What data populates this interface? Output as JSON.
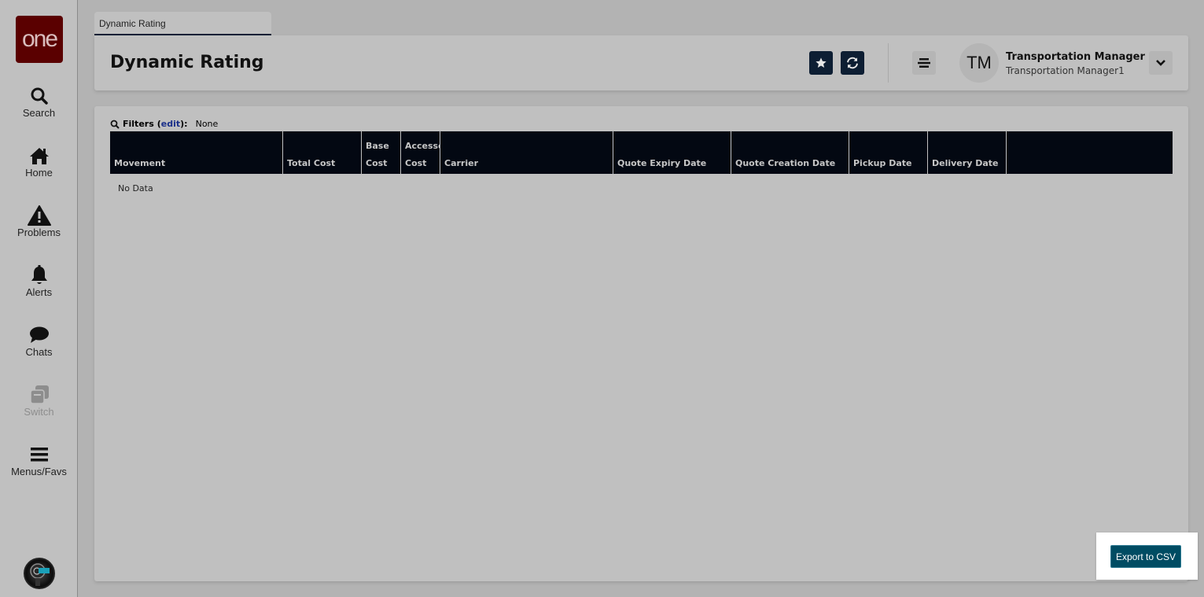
{
  "sidebar": {
    "logo_text": "one",
    "items": [
      {
        "label": "Search",
        "icon": "search-icon",
        "enabled": true
      },
      {
        "label": "Home",
        "icon": "home-icon",
        "enabled": true
      },
      {
        "label": "Problems",
        "icon": "warning-icon",
        "enabled": true
      },
      {
        "label": "Alerts",
        "icon": "bell-icon",
        "enabled": true
      },
      {
        "label": "Chats",
        "icon": "chat-bubble-icon",
        "enabled": true
      },
      {
        "label": "Switch",
        "icon": "switch-windows-icon",
        "enabled": false
      },
      {
        "label": "Menus/Favs",
        "icon": "hamburger-menu-icon",
        "enabled": true
      }
    ]
  },
  "tab": {
    "label": "Dynamic Rating"
  },
  "header": {
    "title": "Dynamic Rating",
    "user": {
      "initials": "TM",
      "name": "Transportation Manager",
      "role": "Transportation Manager1"
    }
  },
  "filters": {
    "label": "Filters",
    "edit_label": "edit",
    "value": "None"
  },
  "table": {
    "columns": [
      {
        "line1": "",
        "line2": "Movement"
      },
      {
        "line1": "",
        "line2": "Total Cost"
      },
      {
        "line1": "Base",
        "line2": "Cost"
      },
      {
        "line1": "Accesso",
        "line2": "Cost"
      },
      {
        "line1": "",
        "line2": "Carrier"
      },
      {
        "line1": "",
        "line2": "Quote Expiry Date"
      },
      {
        "line1": "",
        "line2": "Quote Creation Date"
      },
      {
        "line1": "",
        "line2": "Pickup Date"
      },
      {
        "line1": "",
        "line2": "Delivery Date"
      },
      {
        "line1": "",
        "line2": ""
      }
    ],
    "empty_text": "No Data"
  },
  "actions": {
    "export_label": "Export to CSV"
  },
  "colors": {
    "header_bg": "#030812",
    "primary_btn": "#004c63",
    "logo_bg": "#5a0000",
    "icon_btn": "#0d1e33"
  }
}
